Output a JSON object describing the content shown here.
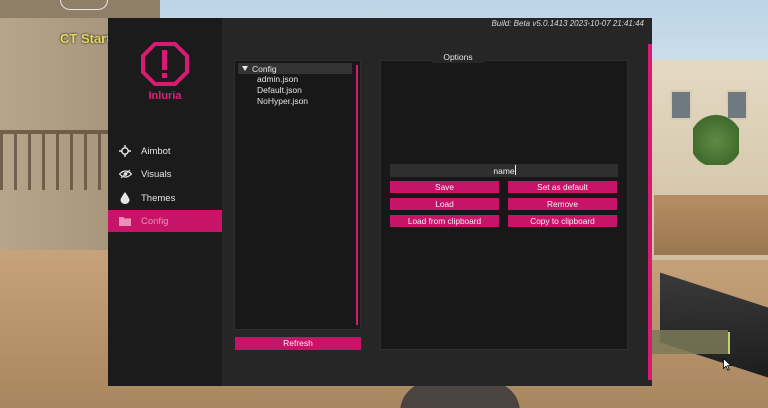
{
  "game": {
    "round_status": "CT Start"
  },
  "menu": {
    "build_info": "Build: Beta v5.0.1413 2023-10-07 21:41:44",
    "brand": {
      "name": "Inluria",
      "accent_color": "#d81b72"
    },
    "nav": [
      {
        "label": "Aimbot",
        "icon": "crosshair-icon",
        "active": false
      },
      {
        "label": "Visuals",
        "icon": "eye-icon",
        "active": false
      },
      {
        "label": "Themes",
        "icon": "droplet-icon",
        "active": false
      },
      {
        "label": "Config",
        "icon": "folder-icon",
        "active": true
      }
    ]
  },
  "config": {
    "tree_title": "Config",
    "files": [
      "admin.json",
      "Default.json",
      "NoHyper.json"
    ],
    "refresh_label": "Refresh"
  },
  "options": {
    "title": "Options",
    "name_value": "name",
    "buttons": {
      "save": "Save",
      "set_default": "Set as default",
      "load": "Load",
      "remove": "Remove",
      "load_clipboard": "Load from clipboard",
      "copy_clipboard": "Copy to clipboard"
    }
  }
}
